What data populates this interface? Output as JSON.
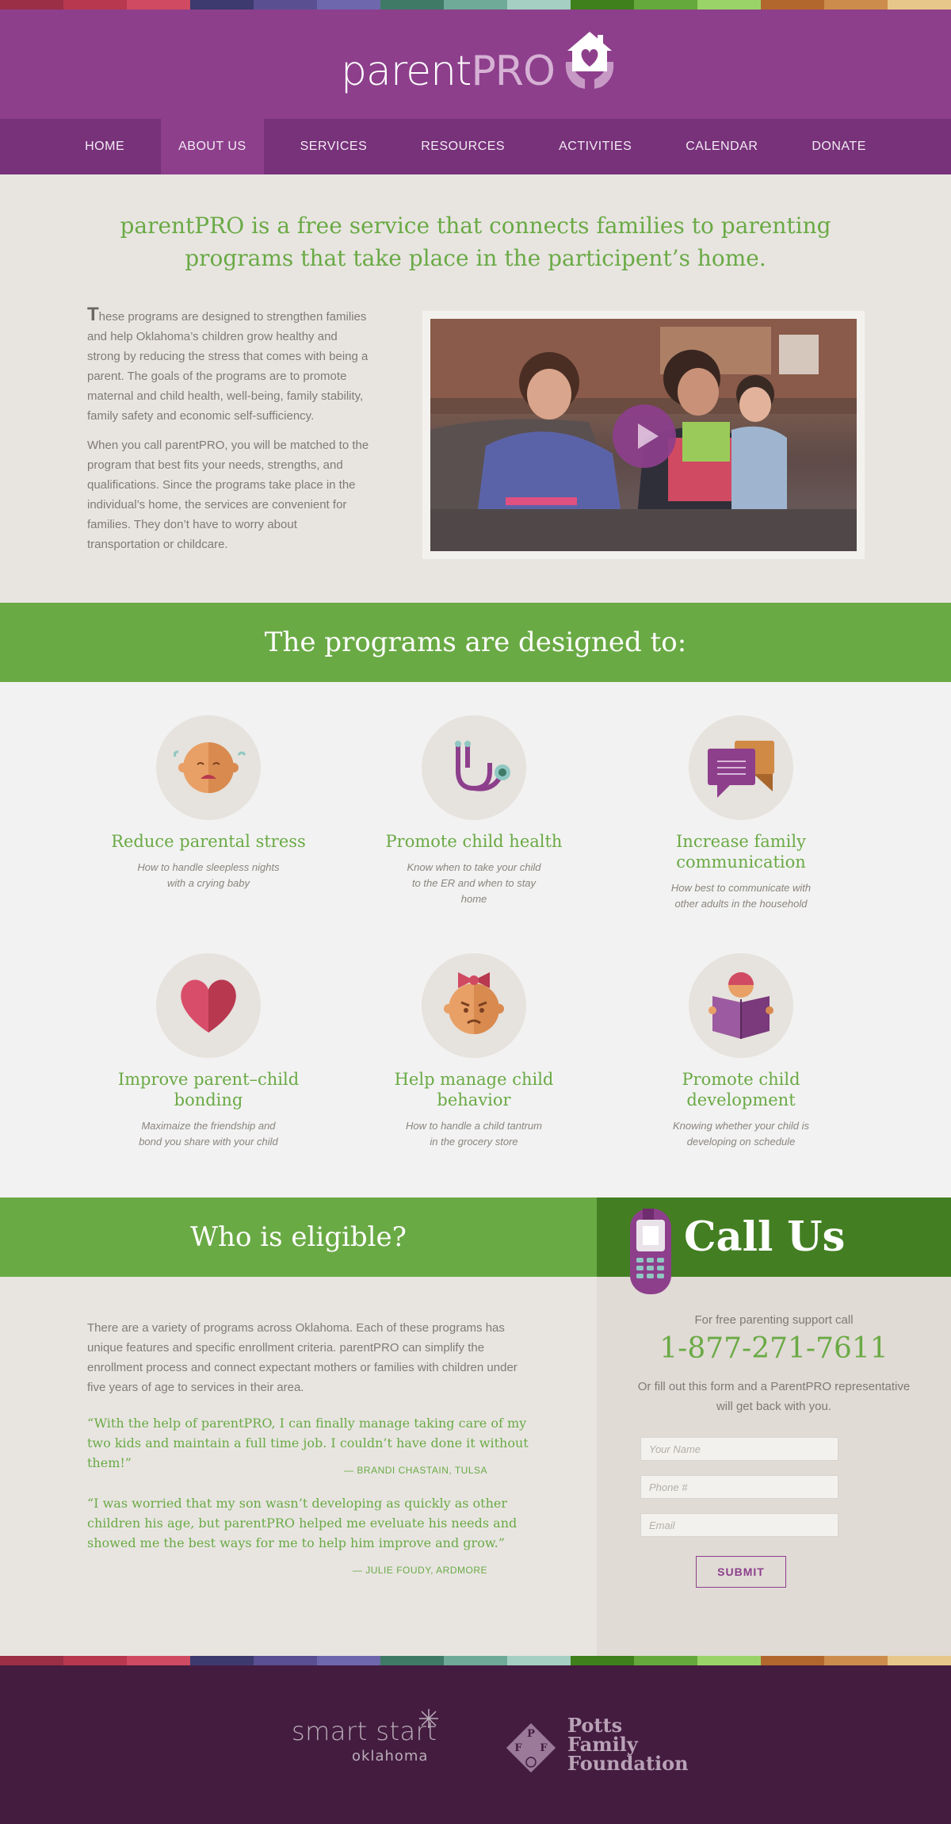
{
  "palette": [
    "#9a2f45",
    "#b8384f",
    "#d04a62",
    "#3c3a6e",
    "#5a4f91",
    "#6e67ad",
    "#3f7a67",
    "#6fa998",
    "#a4cfc2",
    "#3f7f1c",
    "#65a83b",
    "#9ad468",
    "#b2682c",
    "#cc8d4c",
    "#e8c78a"
  ],
  "colors": {
    "purple": "#8d3f8c",
    "nav": "#77327a",
    "green": "#6aaa45",
    "dark_green": "#437f22",
    "footer": "#441c40"
  },
  "brand": {
    "parent": "parent",
    "pro": "PRO"
  },
  "nav": [
    {
      "label": "HOME"
    },
    {
      "label": "ABOUT US",
      "active": true
    },
    {
      "label": "SERVICES"
    },
    {
      "label": "RESOURCES"
    },
    {
      "label": "ACTIVITIES"
    },
    {
      "label": "CALENDAR"
    },
    {
      "label": "DONATE"
    }
  ],
  "intro": {
    "headline": "parentPRO is a free service that connects families to parenting programs that take place in the participent’s home.",
    "dropcap": "T",
    "para1": "hese programs are designed to strengthen families and help Oklahoma’s children grow healthy and strong by reducing the stress that comes with being a parent. The goals of the programs are to promote maternal and child health, well-being, family stability, family safety and economic self-sufficiency.",
    "para2": "When you call parentPRO, you will be matched to the program that best fits your needs, strengths, and qualifications. Since the programs take place in the individual’s home, the services are convenient for families. They don’t have to worry about transportation or childcare.",
    "video_icon": "play-icon"
  },
  "programs_heading": "The programs are designed to:",
  "programs": [
    {
      "icon": "crying-baby-icon",
      "title": "Reduce parental stress",
      "desc": "How to handle sleepless nights with a crying baby"
    },
    {
      "icon": "stethoscope-icon",
      "title": "Promote child health",
      "desc": "Know when to take your child to the ER and when to stay home"
    },
    {
      "icon": "chat-bubbles-icon",
      "title": "Increase family communication",
      "desc": "How best to communicate with other adults in the household"
    },
    {
      "icon": "heart-icon",
      "title": "Improve parent–child bonding",
      "desc": "Maximaize the friendship and bond you share with your child"
    },
    {
      "icon": "angry-child-icon",
      "title": "Help manage child behavior",
      "desc": "How to handle a child tantrum in the grocery store"
    },
    {
      "icon": "reading-child-icon",
      "title": "Promote child development",
      "desc": "Knowing whether your child is developing on schedule"
    }
  ],
  "eligible": {
    "heading": "Who is eligible?",
    "text": "There are a variety of programs across Oklahoma. Each of these programs has unique features and specific enrollment criteria. parentPRO can simplify the enrollment process and connect expectant mothers or families with children under five years of age to services in their area.",
    "quotes": [
      {
        "text": "“With the help of parentPRO, I can finally manage taking care of my two kids and maintain a full time job. I couldn’t have done it without them!”",
        "by": "— BRANDI CHASTAIN, TULSA"
      },
      {
        "text": "“I was worried that my son wasn’t developing as quickly as other children his age, but parentPRO helped me eveluate his needs and showed me the best ways for me to help him improve and grow.”",
        "by": "— JULIE FOUDY, ARDMORE"
      }
    ]
  },
  "call": {
    "heading": "Call Us",
    "support": "For free parenting support call",
    "phone": "1-877-271-7611",
    "note": "Or fill out this form and a ParentPRO representative will get back with you.",
    "fields": {
      "name": "Your Name",
      "phone": "Phone #",
      "email": "Email"
    },
    "submit": "SUBMIT"
  },
  "footer": {
    "smart_start": "smart start",
    "smart_start_sub": "oklahoma",
    "potts_line1": "Potts",
    "potts_line2": "Family",
    "potts_line3": "Foundation",
    "potts_letters": [
      "P",
      "F",
      "F"
    ]
  }
}
